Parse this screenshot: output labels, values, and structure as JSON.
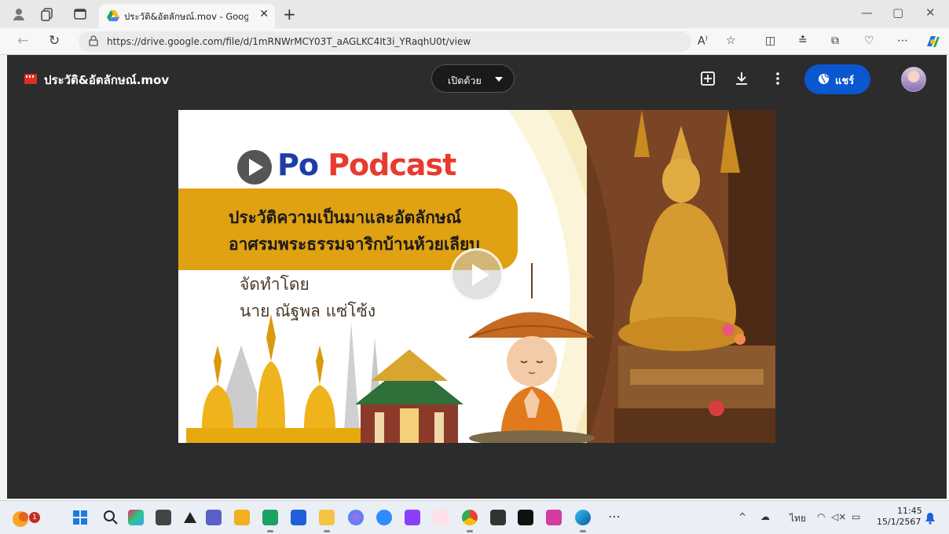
{
  "tab": {
    "title": "ประวัติ&อัตลักษณ์.mov - Google ไดรฟ์"
  },
  "address": {
    "url": "https://drive.google.com/file/d/1mRNWrMCY03T_aAGLKC4It3i_YRaqhU0t/view"
  },
  "viewer": {
    "file_name": "ประวัติ&อัตลักษณ์.mov",
    "open_with_label": "เปิดด้วย",
    "share_label": "แชร์"
  },
  "video": {
    "title_po": "Po",
    "title_podcast": "Podcast",
    "heading_line1": "ประวัติความเป็นมาและอัตลักษณ์",
    "heading_line2": "อาศรมพระธรรมจาริกบ้านห้วยเลียบ",
    "credit_line1": "จัดทำโดย",
    "credit_line2": "นาย ณัฐพล แซ่โซ้ง"
  },
  "taskbar": {
    "notification_count": "1",
    "language": "ไทย",
    "time": "11:45",
    "date": "15/1/2567"
  },
  "colors": {
    "drive_bg": "#2c2c2c",
    "share_blue": "#0b57d0",
    "banner_yellow": "#e0a112",
    "po_blue": "#1e3da8",
    "podcast_red": "#e83a2f"
  }
}
